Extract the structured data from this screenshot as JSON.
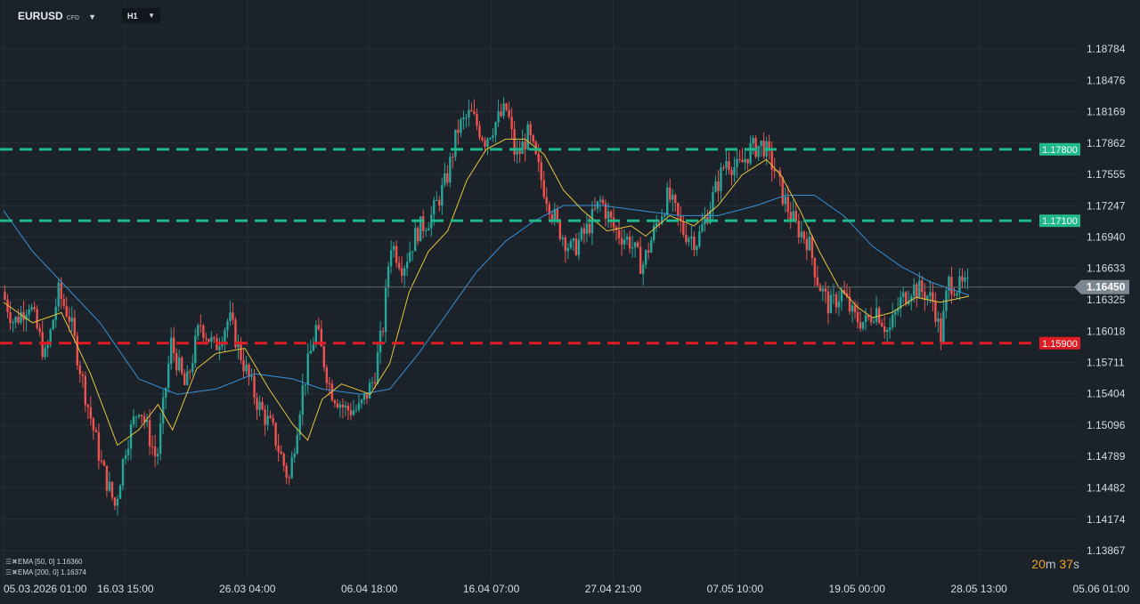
{
  "header": {
    "symbol": "EURUSD",
    "symbol_type": "CFD",
    "symbol_caret": "▼",
    "timeframe": "H1",
    "timeframe_caret": "▼"
  },
  "indicators": [
    {
      "label": "EMA [50, 0] 1.16360",
      "color": "#e8c53a"
    },
    {
      "label": "EMA [200, 0] 1.16374",
      "color": "#3a8fd6"
    }
  ],
  "timer": {
    "minutes": "20",
    "minutes_unit": "m",
    "seconds": "37",
    "seconds_unit": "s"
  },
  "colors": {
    "background": "#1b2229",
    "grid": "#262f37",
    "bull_candle": "#26a69a",
    "bear_candle": "#ef5350",
    "support_line": "#e01c24",
    "resistance_line": "#1fb98a",
    "current_price_tag": "#7d8791"
  },
  "chart_data": {
    "type": "candlestick",
    "title": "",
    "xlabel": "",
    "ylabel": "",
    "ylim": [
      1.13867,
      1.18784
    ],
    "x_ticks": [
      "05.03.2026 01:00",
      "16.03 15:00",
      "26.03 04:00",
      "06.04 18:00",
      "16.04 07:00",
      "27.04 21:00",
      "07.05 10:00",
      "19.05 00:00",
      "28.05 13:00",
      "05.06 01:00"
    ],
    "y_ticks": [
      1.18784,
      1.18476,
      1.18169,
      1.17862,
      1.17555,
      1.17247,
      1.1694,
      1.16633,
      1.16325,
      1.16018,
      1.15711,
      1.15404,
      1.15096,
      1.14789,
      1.14482,
      1.14174,
      1.13867
    ],
    "y_tick_labels": [
      "1.18784",
      "1.18476",
      "1.18169",
      "1.17862",
      "1.17555",
      "1.17247",
      "1.16940",
      "1.16633",
      "1.16325",
      "1.16018",
      "1.15711",
      "1.15404",
      "1.15096",
      "1.14789",
      "1.14482",
      "1.14174",
      "1.13867"
    ],
    "grid": true,
    "horizontal_lines": [
      {
        "price": 1.178,
        "label": "1.17800",
        "style": "dashed",
        "color": "#1fb98a"
      },
      {
        "price": 1.171,
        "label": "1.17100",
        "style": "dashed",
        "color": "#1fb98a"
      },
      {
        "price": 1.159,
        "label": "1.15900",
        "style": "dashed",
        "color": "#e01c24"
      }
    ],
    "current_price": {
      "price": 1.1645,
      "label": "1.16450"
    },
    "price_path": [
      {
        "t": 0.0,
        "p": 1.164
      },
      {
        "t": 0.012,
        "p": 1.161
      },
      {
        "t": 0.028,
        "p": 1.163
      },
      {
        "t": 0.045,
        "p": 1.1575
      },
      {
        "t": 0.058,
        "p": 1.164
      },
      {
        "t": 0.07,
        "p": 1.1615
      },
      {
        "t": 0.085,
        "p": 1.1545
      },
      {
        "t": 0.103,
        "p": 1.147
      },
      {
        "t": 0.117,
        "p": 1.143
      },
      {
        "t": 0.128,
        "p": 1.149
      },
      {
        "t": 0.142,
        "p": 1.153
      },
      {
        "t": 0.16,
        "p": 1.1475
      },
      {
        "t": 0.175,
        "p": 1.159
      },
      {
        "t": 0.19,
        "p": 1.1545
      },
      {
        "t": 0.205,
        "p": 1.161
      },
      {
        "t": 0.22,
        "p": 1.1585
      },
      {
        "t": 0.235,
        "p": 1.1615
      },
      {
        "t": 0.25,
        "p": 1.157
      },
      {
        "t": 0.265,
        "p": 1.153
      },
      {
        "t": 0.28,
        "p": 1.1505
      },
      {
        "t": 0.297,
        "p": 1.1455
      },
      {
        "t": 0.31,
        "p": 1.154
      },
      {
        "t": 0.325,
        "p": 1.1605
      },
      {
        "t": 0.34,
        "p": 1.1545
      },
      {
        "t": 0.355,
        "p": 1.1525
      },
      {
        "t": 0.37,
        "p": 1.1525
      },
      {
        "t": 0.385,
        "p": 1.1555
      },
      {
        "t": 0.395,
        "p": 1.161
      },
      {
        "t": 0.402,
        "p": 1.169
      },
      {
        "t": 0.415,
        "p": 1.1665
      },
      {
        "t": 0.43,
        "p": 1.17
      },
      {
        "t": 0.445,
        "p": 1.1715
      },
      {
        "t": 0.46,
        "p": 1.175
      },
      {
        "t": 0.472,
        "p": 1.18
      },
      {
        "t": 0.485,
        "p": 1.1815
      },
      {
        "t": 0.5,
        "p": 1.179
      },
      {
        "t": 0.51,
        "p": 1.1805
      },
      {
        "t": 0.523,
        "p": 1.182
      },
      {
        "t": 0.532,
        "p": 1.177
      },
      {
        "t": 0.545,
        "p": 1.1795
      },
      {
        "t": 0.56,
        "p": 1.1745
      },
      {
        "t": 0.575,
        "p": 1.1705
      },
      {
        "t": 0.59,
        "p": 1.168
      },
      {
        "t": 0.605,
        "p": 1.17
      },
      {
        "t": 0.62,
        "p": 1.173
      },
      {
        "t": 0.635,
        "p": 1.17
      },
      {
        "t": 0.65,
        "p": 1.169
      },
      {
        "t": 0.663,
        "p": 1.1665
      },
      {
        "t": 0.677,
        "p": 1.1705
      },
      {
        "t": 0.69,
        "p": 1.1735
      },
      {
        "t": 0.705,
        "p": 1.17
      },
      {
        "t": 0.72,
        "p": 1.169
      },
      {
        "t": 0.735,
        "p": 1.173
      },
      {
        "t": 0.75,
        "p": 1.177
      },
      {
        "t": 0.762,
        "p": 1.176
      },
      {
        "t": 0.775,
        "p": 1.178
      },
      {
        "t": 0.788,
        "p": 1.1785
      },
      {
        "t": 0.8,
        "p": 1.176
      },
      {
        "t": 0.81,
        "p": 1.173
      },
      {
        "t": 0.822,
        "p": 1.1705
      },
      {
        "t": 0.835,
        "p": 1.169
      },
      {
        "t": 0.845,
        "p": 1.165
      },
      {
        "t": 0.857,
        "p": 1.1625
      },
      {
        "t": 0.87,
        "p": 1.164
      },
      {
        "t": 0.882,
        "p": 1.1615
      },
      {
        "t": 0.895,
        "p": 1.161
      },
      {
        "t": 0.905,
        "p": 1.1625
      },
      {
        "t": 0.918,
        "p": 1.16
      },
      {
        "t": 0.93,
        "p": 1.163
      },
      {
        "t": 0.942,
        "p": 1.1645
      },
      {
        "t": 0.955,
        "p": 1.164
      },
      {
        "t": 0.965,
        "p": 1.163
      },
      {
        "t": 0.972,
        "p": 1.1595
      },
      {
        "t": 0.98,
        "p": 1.165
      },
      {
        "t": 0.99,
        "p": 1.1645
      },
      {
        "t": 1.0,
        "p": 1.1645
      }
    ],
    "ema50_path": [
      {
        "t": 0.0,
        "p": 1.163
      },
      {
        "t": 0.03,
        "p": 1.161
      },
      {
        "t": 0.06,
        "p": 1.162
      },
      {
        "t": 0.09,
        "p": 1.156
      },
      {
        "t": 0.118,
        "p": 1.149
      },
      {
        "t": 0.14,
        "p": 1.1505
      },
      {
        "t": 0.16,
        "p": 1.153
      },
      {
        "t": 0.175,
        "p": 1.1505
      },
      {
        "t": 0.2,
        "p": 1.1565
      },
      {
        "t": 0.22,
        "p": 1.158
      },
      {
        "t": 0.25,
        "p": 1.1585
      },
      {
        "t": 0.275,
        "p": 1.1545
      },
      {
        "t": 0.3,
        "p": 1.151
      },
      {
        "t": 0.315,
        "p": 1.1495
      },
      {
        "t": 0.33,
        "p": 1.1535
      },
      {
        "t": 0.35,
        "p": 1.155
      },
      {
        "t": 0.38,
        "p": 1.154
      },
      {
        "t": 0.4,
        "p": 1.157
      },
      {
        "t": 0.42,
        "p": 1.164
      },
      {
        "t": 0.44,
        "p": 1.168
      },
      {
        "t": 0.46,
        "p": 1.17
      },
      {
        "t": 0.48,
        "p": 1.175
      },
      {
        "t": 0.5,
        "p": 1.178
      },
      {
        "t": 0.52,
        "p": 1.179
      },
      {
        "t": 0.54,
        "p": 1.179
      },
      {
        "t": 0.56,
        "p": 1.1775
      },
      {
        "t": 0.58,
        "p": 1.174
      },
      {
        "t": 0.6,
        "p": 1.172
      },
      {
        "t": 0.625,
        "p": 1.17
      },
      {
        "t": 0.65,
        "p": 1.1705
      },
      {
        "t": 0.665,
        "p": 1.1695
      },
      {
        "t": 0.69,
        "p": 1.1715
      },
      {
        "t": 0.715,
        "p": 1.1705
      },
      {
        "t": 0.74,
        "p": 1.1725
      },
      {
        "t": 0.765,
        "p": 1.1755
      },
      {
        "t": 0.79,
        "p": 1.177
      },
      {
        "t": 0.805,
        "p": 1.1755
      },
      {
        "t": 0.825,
        "p": 1.172
      },
      {
        "t": 0.845,
        "p": 1.168
      },
      {
        "t": 0.865,
        "p": 1.1645
      },
      {
        "t": 0.885,
        "p": 1.1625
      },
      {
        "t": 0.9,
        "p": 1.1615
      },
      {
        "t": 0.92,
        "p": 1.162
      },
      {
        "t": 0.945,
        "p": 1.1635
      },
      {
        "t": 0.97,
        "p": 1.163
      },
      {
        "t": 1.0,
        "p": 1.1636
      }
    ],
    "ema200_path": [
      {
        "t": 0.0,
        "p": 1.172
      },
      {
        "t": 0.03,
        "p": 1.168
      },
      {
        "t": 0.06,
        "p": 1.165
      },
      {
        "t": 0.1,
        "p": 1.161
      },
      {
        "t": 0.14,
        "p": 1.1555
      },
      {
        "t": 0.18,
        "p": 1.154
      },
      {
        "t": 0.22,
        "p": 1.1545
      },
      {
        "t": 0.26,
        "p": 1.156
      },
      {
        "t": 0.3,
        "p": 1.1555
      },
      {
        "t": 0.33,
        "p": 1.1545
      },
      {
        "t": 0.37,
        "p": 1.154
      },
      {
        "t": 0.4,
        "p": 1.1545
      },
      {
        "t": 0.43,
        "p": 1.158
      },
      {
        "t": 0.46,
        "p": 1.162
      },
      {
        "t": 0.49,
        "p": 1.166
      },
      {
        "t": 0.52,
        "p": 1.169
      },
      {
        "t": 0.55,
        "p": 1.171
      },
      {
        "t": 0.58,
        "p": 1.1725
      },
      {
        "t": 0.62,
        "p": 1.1725
      },
      {
        "t": 0.66,
        "p": 1.172
      },
      {
        "t": 0.7,
        "p": 1.1715
      },
      {
        "t": 0.74,
        "p": 1.1715
      },
      {
        "t": 0.78,
        "p": 1.1725
      },
      {
        "t": 0.81,
        "p": 1.1735
      },
      {
        "t": 0.84,
        "p": 1.1735
      },
      {
        "t": 0.87,
        "p": 1.1715
      },
      {
        "t": 0.9,
        "p": 1.1685
      },
      {
        "t": 0.93,
        "p": 1.1665
      },
      {
        "t": 0.96,
        "p": 1.165
      },
      {
        "t": 1.0,
        "p": 1.1637
      }
    ]
  }
}
